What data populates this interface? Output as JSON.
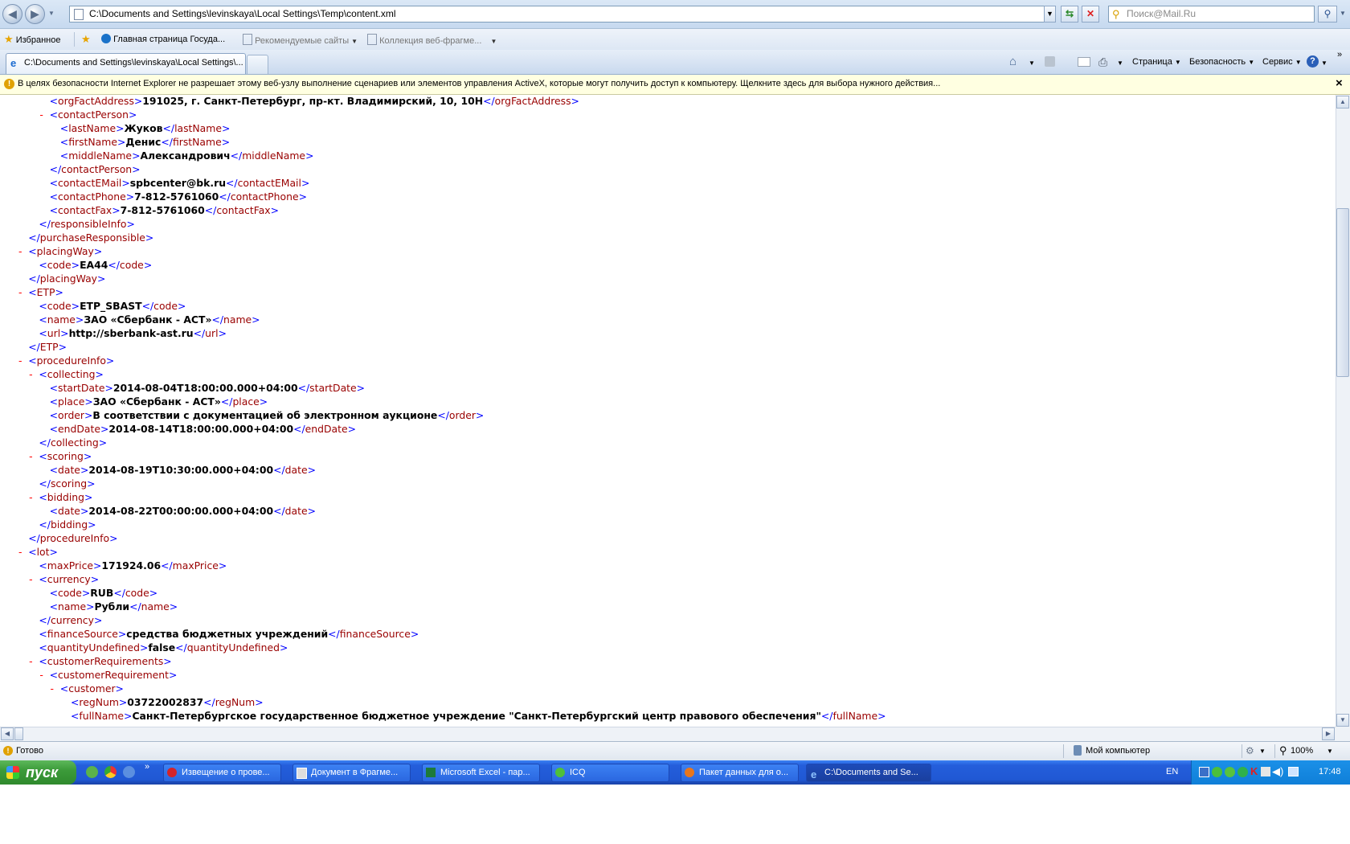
{
  "browser": {
    "address": "C:\\Documents and Settings\\levinskaya\\Local Settings\\Temp\\content.xml",
    "search_placeholder": "Поиск@Mail.Ru"
  },
  "favorites": {
    "label": "Избранное",
    "items": [
      "Главная страница  Госуда...",
      "Рекомендуемые сайты",
      "Коллекция веб-фрагме..."
    ]
  },
  "tabs": [
    {
      "label": "C:\\Documents and Settings\\levinskaya\\Local Settings\\..."
    }
  ],
  "commands": {
    "page": "Страница",
    "security": "Безопасность",
    "service": "Сервис"
  },
  "infobar": {
    "text": "В целях безопасности Internet Explorer не разрешает этому веб-узлу выполнение сценариев или элементов управления ActiveX, которые могут получить доступ к компьютеру. Щелкните здесь для выбора нужного действия...",
    "close": "×"
  },
  "xml_lines": [
    {
      "ind": 3,
      "m": "",
      "o": "orgFactAddress",
      "t": "191025, г. Санкт-Петербург, пр-кт. Владимирский, 10, 10Н",
      "c": "orgFactAddress"
    },
    {
      "ind": 3,
      "m": "-",
      "o": "contactPerson",
      "t": "",
      "c": ""
    },
    {
      "ind": 4,
      "m": "",
      "o": "lastName",
      "t": "Жуков",
      "c": "lastName"
    },
    {
      "ind": 4,
      "m": "",
      "o": "firstName",
      "t": "Денис",
      "c": "firstName"
    },
    {
      "ind": 4,
      "m": "",
      "o": "middleName",
      "t": "Александрович",
      "c": "middleName"
    },
    {
      "ind": 3,
      "m": "",
      "o": "",
      "t": "",
      "c": "contactPerson"
    },
    {
      "ind": 3,
      "m": "",
      "o": "contactEMail",
      "t": "spbcenter@bk.ru",
      "c": "contactEMail"
    },
    {
      "ind": 3,
      "m": "",
      "o": "contactPhone",
      "t": "7-812-5761060",
      "c": "contactPhone"
    },
    {
      "ind": 3,
      "m": "",
      "o": "contactFax",
      "t": "7-812-5761060",
      "c": "contactFax"
    },
    {
      "ind": 2,
      "m": "",
      "o": "",
      "t": "",
      "c": "responsibleInfo"
    },
    {
      "ind": 1,
      "m": "",
      "o": "",
      "t": "",
      "c": "purchaseResponsible"
    },
    {
      "ind": 1,
      "m": "-",
      "o": "placingWay",
      "t": "",
      "c": ""
    },
    {
      "ind": 2,
      "m": "",
      "o": "code",
      "t": "EA44",
      "c": "code"
    },
    {
      "ind": 1,
      "m": "",
      "o": "",
      "t": "",
      "c": "placingWay"
    },
    {
      "ind": 1,
      "m": "-",
      "o": "ETP",
      "t": "",
      "c": ""
    },
    {
      "ind": 2,
      "m": "",
      "o": "code",
      "t": "ETP_SBAST",
      "c": "code"
    },
    {
      "ind": 2,
      "m": "",
      "o": "name",
      "t": "ЗАО «Сбербанк - АСТ»",
      "c": "name"
    },
    {
      "ind": 2,
      "m": "",
      "o": "url",
      "t": "http://sberbank-ast.ru",
      "c": "url"
    },
    {
      "ind": 1,
      "m": "",
      "o": "",
      "t": "",
      "c": "ETP"
    },
    {
      "ind": 1,
      "m": "-",
      "o": "procedureInfo",
      "t": "",
      "c": ""
    },
    {
      "ind": 2,
      "m": "-",
      "o": "collecting",
      "t": "",
      "c": ""
    },
    {
      "ind": 3,
      "m": "",
      "o": "startDate",
      "t": "2014-08-04T18:00:00.000+04:00",
      "c": "startDate"
    },
    {
      "ind": 3,
      "m": "",
      "o": "place",
      "t": "ЗАО «Сбербанк - АСТ»",
      "c": "place"
    },
    {
      "ind": 3,
      "m": "",
      "o": "order",
      "t": "В соответствии с документацией об электронном аукционе",
      "c": "order"
    },
    {
      "ind": 3,
      "m": "",
      "o": "endDate",
      "t": "2014-08-14T18:00:00.000+04:00",
      "c": "endDate"
    },
    {
      "ind": 2,
      "m": "",
      "o": "",
      "t": "",
      "c": "collecting"
    },
    {
      "ind": 2,
      "m": "-",
      "o": "scoring",
      "t": "",
      "c": ""
    },
    {
      "ind": 3,
      "m": "",
      "o": "date",
      "t": "2014-08-19T10:30:00.000+04:00",
      "c": "date"
    },
    {
      "ind": 2,
      "m": "",
      "o": "",
      "t": "",
      "c": "scoring"
    },
    {
      "ind": 2,
      "m": "-",
      "o": "bidding",
      "t": "",
      "c": ""
    },
    {
      "ind": 3,
      "m": "",
      "o": "date",
      "t": "2014-08-22T00:00:00.000+04:00",
      "c": "date"
    },
    {
      "ind": 2,
      "m": "",
      "o": "",
      "t": "",
      "c": "bidding"
    },
    {
      "ind": 1,
      "m": "",
      "o": "",
      "t": "",
      "c": "procedureInfo"
    },
    {
      "ind": 1,
      "m": "-",
      "o": "lot",
      "t": "",
      "c": ""
    },
    {
      "ind": 2,
      "m": "",
      "o": "maxPrice",
      "t": "171924.06",
      "c": "maxPrice"
    },
    {
      "ind": 2,
      "m": "-",
      "o": "currency",
      "t": "",
      "c": ""
    },
    {
      "ind": 3,
      "m": "",
      "o": "code",
      "t": "RUB",
      "c": "code"
    },
    {
      "ind": 3,
      "m": "",
      "o": "name",
      "t": "Рубли",
      "c": "name"
    },
    {
      "ind": 2,
      "m": "",
      "o": "",
      "t": "",
      "c": "currency"
    },
    {
      "ind": 2,
      "m": "",
      "o": "financeSource",
      "t": "средства бюджетных учреждений",
      "c": "financeSource"
    },
    {
      "ind": 2,
      "m": "",
      "o": "quantityUndefined",
      "t": "false",
      "c": "quantityUndefined"
    },
    {
      "ind": 2,
      "m": "-",
      "o": "customerRequirements",
      "t": "",
      "c": ""
    },
    {
      "ind": 3,
      "m": "-",
      "o": "customerRequirement",
      "t": "",
      "c": ""
    },
    {
      "ind": 4,
      "m": "-",
      "o": "customer",
      "t": "",
      "c": ""
    },
    {
      "ind": 5,
      "m": "",
      "o": "regNum",
      "t": "03722002837",
      "c": "regNum"
    },
    {
      "ind": 5,
      "m": "",
      "o": "fullName",
      "t": "Санкт-Петербургское государственное бюджетное учреждение \"Санкт-Петербургский центр правового обеспечения\"",
      "c": "fullName"
    }
  ],
  "statusbar": {
    "status": "Готово",
    "zone": "Мой компьютер",
    "zoom": "100%"
  },
  "taskbar": {
    "start": "пуск",
    "tasks": [
      "Извещение о прове...",
      "Документ в Фрагме...",
      "Microsoft Excel - пар...",
      "ICQ",
      "Пакет данных для о...",
      "C:\\Documents and Se..."
    ],
    "lang": "EN",
    "clock": "17:48"
  }
}
